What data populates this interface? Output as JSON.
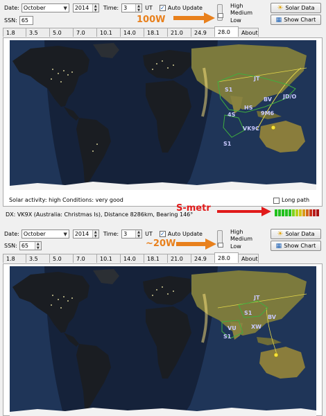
{
  "panel_top": {
    "date_label": "Date:",
    "month": "October",
    "year": "2014",
    "time_label": "Time:",
    "time_value": "3",
    "time_unit": "UT",
    "auto_update_label": "Auto Update",
    "ssn_label": "SSN:",
    "ssn_value": "65",
    "power_levels": [
      "High",
      "Medium",
      "Low"
    ],
    "solar_data_label": "Solar Data",
    "show_chart_label": "Show Chart",
    "tabs": [
      "1.8",
      "3.5",
      "5.0",
      "7.0",
      "10.1",
      "14.0",
      "18.1",
      "21.0",
      "24.9",
      "28.0",
      "About"
    ],
    "active_tab": "28.0",
    "map_labels": [
      "S1",
      "JT",
      "BV",
      "JD/O",
      "HS",
      "9M6",
      "4S",
      "VK9C",
      "S1"
    ],
    "solar_activity": "Solar activity: high  Conditions: very good",
    "long_path_label": "Long path",
    "dx_info": "DX: VK9X (Australia: Christmas Is), Distance  8286km, Bearing 146°",
    "annotation_power": "100W",
    "annotation_smeter": "S-metr",
    "smeter_colors": [
      "#23c11f",
      "#23c11f",
      "#23c11f",
      "#23c11f",
      "#23c11f",
      "#7fd21d",
      "#b7d01a",
      "#d4c21a",
      "#d89a1b",
      "#d2671b",
      "#c8321b",
      "#b81b1b",
      "#a81212"
    ]
  },
  "panel_bottom": {
    "date_label": "Date:",
    "month": "October",
    "year": "2014",
    "time_label": "Time:",
    "time_value": "3",
    "time_unit": "UT",
    "auto_update_label": "Auto Update",
    "ssn_label": "SSN:",
    "ssn_value": "65",
    "power_levels": [
      "High",
      "Medium",
      "Low"
    ],
    "solar_data_label": "Solar Data",
    "show_chart_label": "Show Chart",
    "tabs": [
      "1.8",
      "3.5",
      "5.0",
      "7.0",
      "10.1",
      "14.0",
      "18.1",
      "21.0",
      "24.9",
      "28.0",
      "About"
    ],
    "active_tab": "28.0",
    "map_labels": [
      "S1",
      "JT",
      "BV",
      "VU",
      "XW",
      "S1"
    ],
    "annotation_power": "~20W"
  },
  "colors": {
    "annotation": "#e8801c",
    "arrow_red": "#e11b1b",
    "ocean": "#1f3558",
    "land_night": "#202020",
    "land_day": "#7c7a3d",
    "path_yellow": "#e5d84a",
    "zone_green": "#3fae3f"
  }
}
